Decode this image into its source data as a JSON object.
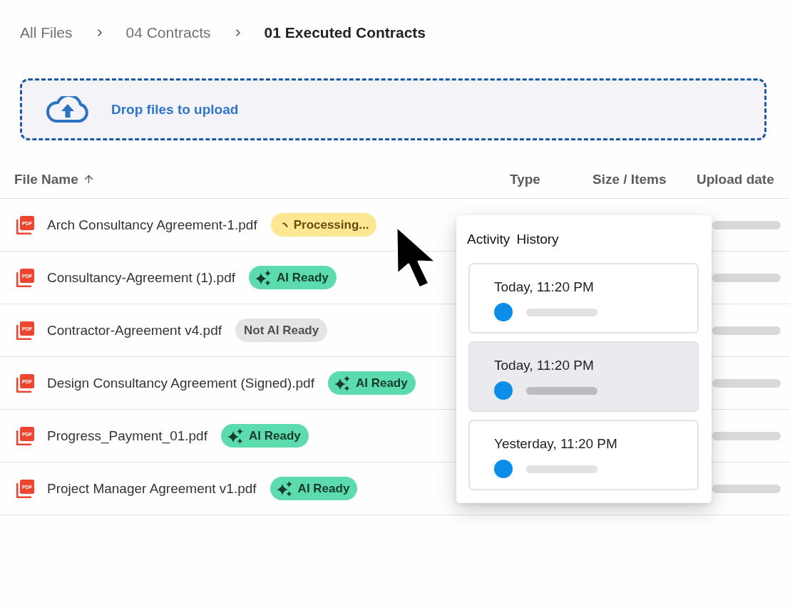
{
  "breadcrumb": [
    {
      "label": "All Files",
      "current": false
    },
    {
      "label": "04 Contracts",
      "current": false
    },
    {
      "label": "01 Executed Contracts",
      "current": true
    }
  ],
  "upload_zone": {
    "label": "Drop files to upload"
  },
  "table": {
    "columns": [
      {
        "label": "File Name",
        "sorted": true
      },
      {
        "label": "Type",
        "sorted": false
      },
      {
        "label": "Size / Items",
        "sorted": false
      },
      {
        "label": "Upload date",
        "sorted": false
      }
    ],
    "rows": [
      {
        "icon_label": "PDF",
        "name": "Arch Consultancy Agreement-1.pdf",
        "status": {
          "kind": "processing",
          "label": "Processing..."
        }
      },
      {
        "icon_label": "PDF",
        "name": "Consultancy-Agreement (1).pdf",
        "status": {
          "kind": "ai_ready",
          "label": "AI Ready"
        }
      },
      {
        "icon_label": "PDF",
        "name": "Contractor-Agreement v4.pdf",
        "status": {
          "kind": "not_ready",
          "label": "Not AI Ready"
        }
      },
      {
        "icon_label": "PDF",
        "name": "Design Consultancy Agreement (Signed).pdf",
        "status": {
          "kind": "ai_ready",
          "label": "AI Ready"
        }
      },
      {
        "icon_label": "PDF",
        "name": "Progress_Payment_01.pdf",
        "status": {
          "kind": "ai_ready",
          "label": "AI Ready"
        }
      },
      {
        "icon_label": "PDF",
        "name": "Project Manager Agreement v1.pdf",
        "status": {
          "kind": "ai_ready",
          "label": "AI Ready"
        }
      }
    ]
  },
  "activity_history": {
    "title": "Activity History",
    "items": [
      {
        "time": "Today, 11:20 PM",
        "selected": false
      },
      {
        "time": "Today, 11:20 PM",
        "selected": true
      },
      {
        "time": "Yesterday, 11:20 PM",
        "selected": false
      }
    ]
  }
}
